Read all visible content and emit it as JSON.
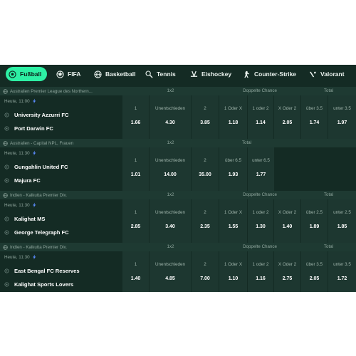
{
  "tabs": [
    {
      "label": "Fußball",
      "icon": "soccer-ball-icon",
      "active": true
    },
    {
      "label": "FIFA",
      "icon": "fifa-ball-icon"
    },
    {
      "label": "Basketball",
      "icon": "basketball-icon"
    },
    {
      "label": "Tennis",
      "icon": "tennis-icon"
    },
    {
      "label": "Eishockey",
      "icon": "hockey-icon"
    },
    {
      "label": "Counter-Strike",
      "icon": "counter-strike-icon"
    },
    {
      "label": "Valorant",
      "icon": "valorant-icon"
    }
  ],
  "headers": {
    "one_x_two": "1x2",
    "double_chance": "Doppelte Chance",
    "total": "Total"
  },
  "markets": {
    "one": "1",
    "draw": "Unentschieden",
    "two": "2",
    "one_or_x": "1 Oder X",
    "one_or_two": "1 oder 2",
    "x_or_two": "X Oder 2"
  },
  "colors": {
    "background": "#142b24",
    "header": "#1e3a32",
    "cell": "#1d3730",
    "accent": "#2df0a4"
  },
  "matches": [
    {
      "league": "Australien Premier League des Northern...",
      "time": "Heute, 11:00",
      "home": "University Azzurri FC",
      "away": "Port Darwin FC",
      "odds": {
        "one": "1.66",
        "draw": "4.30",
        "two": "3.85",
        "one_or_x": "1.18",
        "one_or_two": "1.14",
        "x_or_two": "2.05"
      },
      "total": {
        "over_label": "über 3.5",
        "over": "1.74",
        "under_label": "unter 3.5",
        "under": "1.97"
      }
    },
    {
      "league": "Australien - Capital NPL, Frauen",
      "time": "Heute, 11:30",
      "home": "Gungahlin United FC",
      "away": "Majura FC",
      "odds": {
        "one": "1.01",
        "draw": "14.00",
        "two": "35.00"
      },
      "total": {
        "over_label": "über 6.5",
        "over": "1.93",
        "under_label": "unter 6.5",
        "under": "1.77"
      }
    },
    {
      "league": "Indien - Kalkutta Premier Div.",
      "time": "Heute, 11:30",
      "home": "Kalighat MS",
      "away": "George Telegraph FC",
      "odds": {
        "one": "2.85",
        "draw": "3.40",
        "two": "2.35",
        "one_or_x": "1.55",
        "one_or_two": "1.30",
        "x_or_two": "1.40"
      },
      "total": {
        "over_label": "über 2.5",
        "over": "1.89",
        "under_label": "unter 2.5",
        "under": "1.85"
      }
    },
    {
      "league": "Indien - Kalkutta Premier Div.",
      "time": "Heute, 11:30",
      "home": "East Bengal FC Reserves",
      "away": "Kalighat Sports Lovers",
      "odds": {
        "one": "1.40",
        "draw": "4.85",
        "two": "7.00",
        "one_or_x": "1.10",
        "one_or_two": "1.16",
        "x_or_two": "2.75"
      },
      "total": {
        "over_label": "über 3.5",
        "over": "2.05",
        "under_label": "unter 3.5",
        "under": "1.72"
      }
    }
  ]
}
